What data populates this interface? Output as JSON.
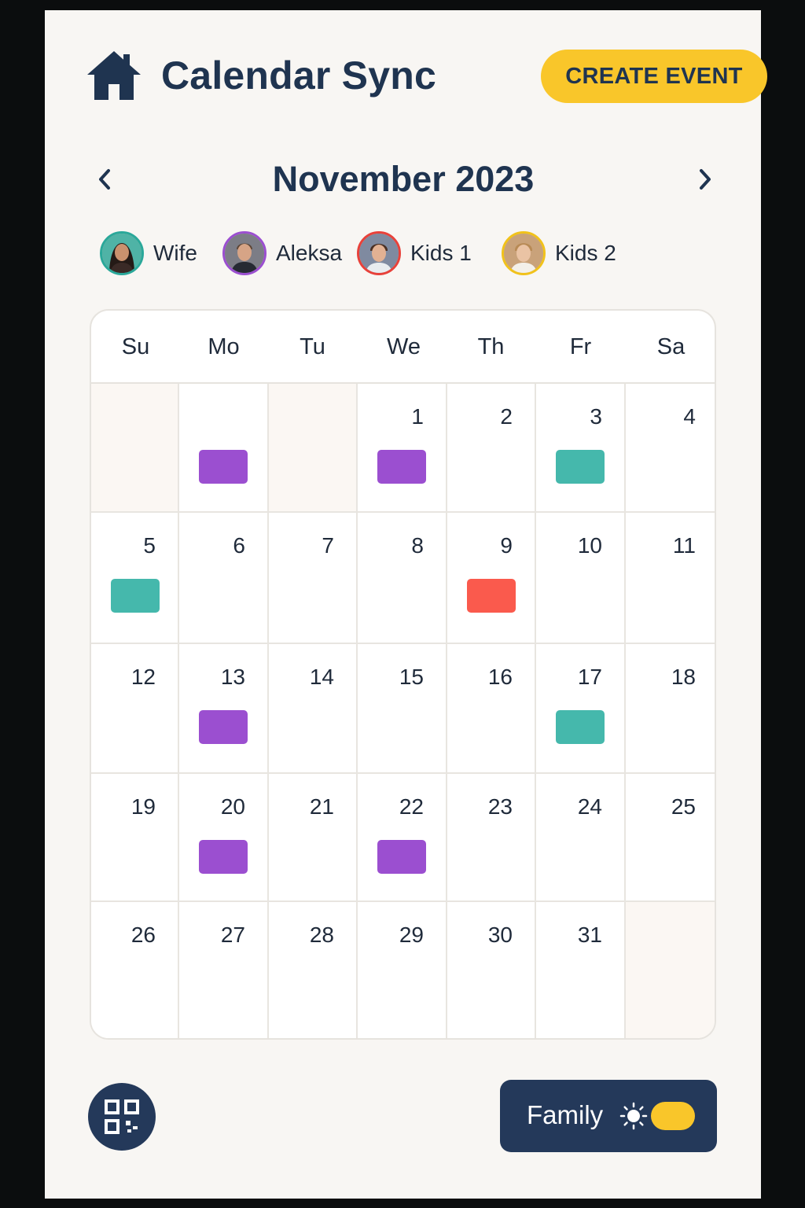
{
  "header": {
    "title": "Calendar Sync",
    "create_button": "CREATE EVENT",
    "icon": "home-icon"
  },
  "month_nav": {
    "label": "November 2023",
    "prev_icon": "chevron-left-icon",
    "next_icon": "chevron-right-icon"
  },
  "members": [
    {
      "name": "Wife",
      "color": "#2aa89a"
    },
    {
      "name": "Aleksa",
      "color": "#9b4fd0"
    },
    {
      "name": "Kids 1",
      "color": "#e8413a"
    },
    {
      "name": "Kids 2",
      "color": "#f1c21b"
    }
  ],
  "weekdays": [
    "Su",
    "Mo",
    "Tu",
    "We",
    "Th",
    "Fr",
    "Sa"
  ],
  "weeks": [
    [
      {
        "day": ""
      },
      {
        "day": "",
        "event": "Aleksa"
      },
      {
        "day": ""
      },
      {
        "day": "1",
        "event": "Aleksa"
      },
      {
        "day": "2"
      },
      {
        "day": "3",
        "event": "Wife"
      },
      {
        "day": "4"
      }
    ],
    [
      {
        "day": "5",
        "event": "Wife"
      },
      {
        "day": "6"
      },
      {
        "day": "7"
      },
      {
        "day": "8"
      },
      {
        "day": "9",
        "event": "Kids 1"
      },
      {
        "day": "10"
      },
      {
        "day": "11"
      }
    ],
    [
      {
        "day": "12"
      },
      {
        "day": "13",
        "event": "Aleksa"
      },
      {
        "day": "14"
      },
      {
        "day": "15"
      },
      {
        "day": "16"
      },
      {
        "day": "17",
        "event": "Wife"
      },
      {
        "day": "18"
      }
    ],
    [
      {
        "day": "19"
      },
      {
        "day": "20",
        "event": "Aleksa"
      },
      {
        "day": "21"
      },
      {
        "day": "22",
        "event": "Aleksa"
      },
      {
        "day": "23"
      },
      {
        "day": "24"
      },
      {
        "day": "25"
      }
    ],
    [
      {
        "day": "26"
      },
      {
        "day": "27"
      },
      {
        "day": "28"
      },
      {
        "day": "29"
      },
      {
        "day": "30"
      },
      {
        "day": "31"
      },
      {
        "day": ""
      }
    ]
  ],
  "event_colors": {
    "Aleksa": "#9b4fd0",
    "Wife": "#45b8ac",
    "Kids 1": "#fa5a4d"
  },
  "footer": {
    "qr_icon": "qr-code-icon",
    "toggle_label": "Family",
    "toggle_icon": "sun-icon",
    "toggle_on": true
  },
  "colors": {
    "navy": "#1f3450",
    "accent": "#f9c62a",
    "button_dark": "#24395a"
  }
}
